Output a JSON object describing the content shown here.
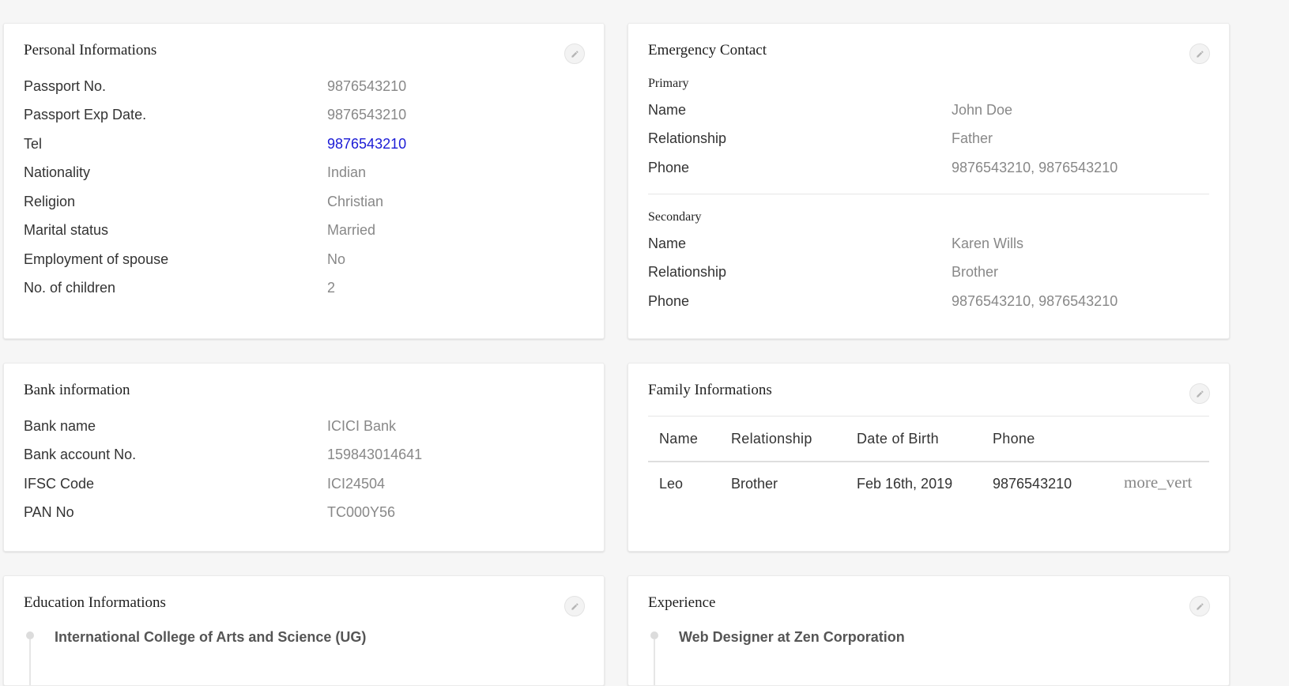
{
  "personal": {
    "title": "Personal Informations",
    "rows": [
      {
        "label": "Passport No.",
        "value": "9876543210"
      },
      {
        "label": "Passport Exp Date.",
        "value": "9876543210"
      },
      {
        "label": "Tel",
        "value": "9876543210"
      },
      {
        "label": "Nationality",
        "value": "Indian"
      },
      {
        "label": "Religion",
        "value": "Christian"
      },
      {
        "label": "Marital status",
        "value": "Married"
      },
      {
        "label": "Employment of spouse",
        "value": "No"
      },
      {
        "label": "No. of children",
        "value": "2"
      }
    ]
  },
  "emergency": {
    "title": "Emergency Contact",
    "primary": {
      "heading": "Primary",
      "rows": [
        {
          "label": "Name",
          "value": "John Doe"
        },
        {
          "label": "Relationship",
          "value": "Father"
        },
        {
          "label": "Phone",
          "value": "9876543210, 9876543210"
        }
      ]
    },
    "secondary": {
      "heading": "Secondary",
      "rows": [
        {
          "label": "Name",
          "value": "Karen Wills"
        },
        {
          "label": "Relationship",
          "value": "Brother"
        },
        {
          "label": "Phone",
          "value": "9876543210, 9876543210"
        }
      ]
    }
  },
  "bank": {
    "title": "Bank information",
    "rows": [
      {
        "label": "Bank name",
        "value": "ICICI Bank"
      },
      {
        "label": "Bank account No.",
        "value": "159843014641"
      },
      {
        "label": "IFSC Code",
        "value": "ICI24504"
      },
      {
        "label": "PAN No",
        "value": "TC000Y56"
      }
    ]
  },
  "family": {
    "title": "Family Informations",
    "headers": [
      "Name",
      "Relationship",
      "Date of Birth",
      "Phone"
    ],
    "rows": [
      {
        "name": "Leo",
        "relationship": "Brother",
        "dob": "Feb 16th, 2019",
        "phone": "9876543210",
        "action": "more_vert"
      }
    ]
  },
  "education": {
    "title": "Education Informations",
    "items": [
      {
        "title": "International College of Arts and Science (UG)"
      }
    ]
  },
  "experience": {
    "title": "Experience",
    "items": [
      {
        "title": "Web Designer at Zen Corporation"
      }
    ]
  },
  "icons": {
    "edit": "pencil-icon",
    "timeline_marker": "timeline-dot-icon",
    "row_menu": "more-vert-icon"
  },
  "colors": {
    "link": "#1b1bd6",
    "value_text": "#888888",
    "page_background": "#f6f6f6"
  }
}
